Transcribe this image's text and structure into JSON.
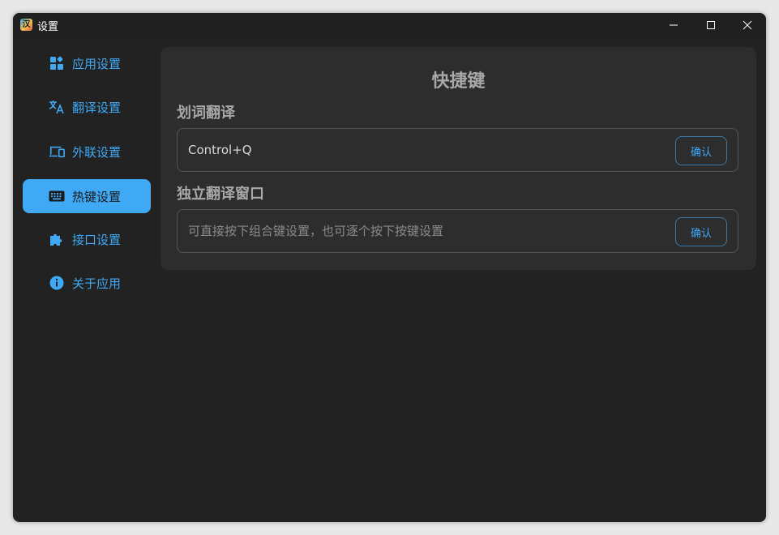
{
  "window": {
    "title": "设置",
    "app_icon_glyph": "汉"
  },
  "sidebar": {
    "items": [
      {
        "label": "应用设置",
        "icon": "apps-icon"
      },
      {
        "label": "翻译设置",
        "icon": "translate-icon"
      },
      {
        "label": "外联设置",
        "icon": "devices-icon"
      },
      {
        "label": "热键设置",
        "icon": "keyboard-icon",
        "active": true
      },
      {
        "label": "接口设置",
        "icon": "puzzle-icon"
      },
      {
        "label": "关于应用",
        "icon": "info-icon"
      }
    ]
  },
  "main": {
    "title": "快捷键",
    "selection_translate": {
      "label": "划词翻译",
      "value": "Control+Q",
      "confirm_label": "确认"
    },
    "standalone_window": {
      "label": "独立翻译窗口",
      "value": "",
      "placeholder": "可直接按下组合键设置，也可逐个按下按键设置",
      "confirm_label": "确认"
    }
  },
  "colors": {
    "accent": "#3fa9f5",
    "background": "#222222",
    "panel": "#2d2d2d",
    "text_muted": "#a8a8a8"
  }
}
